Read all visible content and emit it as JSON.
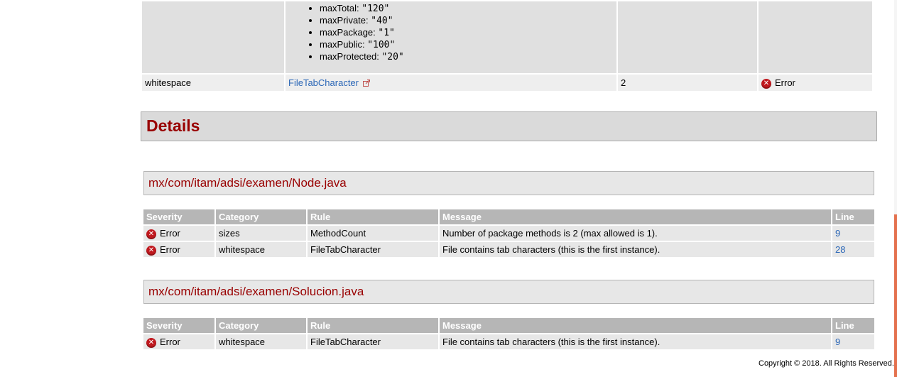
{
  "rules_table": {
    "props": [
      {
        "name": "maxTotal: ",
        "value": "\"120\""
      },
      {
        "name": "maxPrivate: ",
        "value": "\"40\""
      },
      {
        "name": "maxPackage: ",
        "value": "\"1\""
      },
      {
        "name": "maxPublic: ",
        "value": "\"100\""
      },
      {
        "name": "maxProtected: ",
        "value": "\"20\""
      }
    ],
    "row_whitespace": {
      "category": "whitespace",
      "rule": "FileTabCharacter",
      "violations": "2",
      "severity": "Error",
      "link_icon": "external-link-icon"
    }
  },
  "details": {
    "heading": "Details"
  },
  "table_headers": {
    "severity": "Severity",
    "category": "Category",
    "rule": "Rule",
    "message": "Message",
    "line": "Line"
  },
  "files": [
    {
      "path": "mx/com/itam/adsi/examen/Node.java",
      "rows": [
        {
          "severity": "Error",
          "category": "sizes",
          "rule": "MethodCount",
          "message": "Number of package methods is 2 (max allowed is 1).",
          "line": "9"
        },
        {
          "severity": "Error",
          "category": "whitespace",
          "rule": "FileTabCharacter",
          "message": "File contains tab characters (this is the first instance).",
          "line": "28"
        }
      ]
    },
    {
      "path": "mx/com/itam/adsi/examen/Solucion.java",
      "rows": [
        {
          "severity": "Error",
          "category": "whitespace",
          "rule": "FileTabCharacter",
          "message": "File contains tab characters (this is the first instance).",
          "line": "9"
        }
      ]
    }
  ],
  "footer": {
    "copyright": "Copyright © 2018. All Rights Reserved."
  },
  "colors": {
    "heading": "#990000",
    "link": "#2b67b7",
    "error": "#c0181e",
    "header_bg": "#b6b6b6"
  }
}
